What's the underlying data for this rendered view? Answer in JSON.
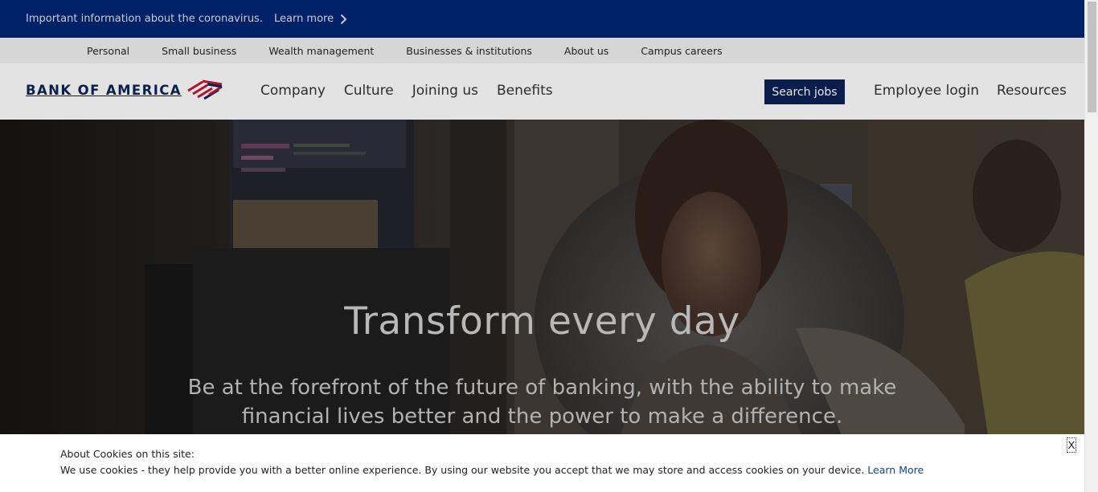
{
  "alert": {
    "text": "Important information about the coronavirus.",
    "link_label": "Learn more"
  },
  "utility_nav": [
    "Personal",
    "Small business",
    "Wealth management",
    "Businesses & institutions",
    "About us",
    "Campus careers"
  ],
  "header": {
    "logo_text": "BANK OF AMERICA",
    "nav": [
      "Company",
      "Culture",
      "Joining us",
      "Benefits"
    ],
    "search_jobs_label": "Search jobs",
    "employee_login_label": "Employee login",
    "resources_label": "Resources"
  },
  "hero": {
    "title": "Transform every day",
    "subtitle": "Be at the forefront of the future of banking, with the ability to make financial lives better and the power to make a difference."
  },
  "cookie": {
    "title": "About Cookies on this site:",
    "text": "We use cookies - they help provide you with a better online experience. By using our website you accept that we may store and access cookies on your device.",
    "link_label": "Learn More",
    "close_label": "X"
  },
  "colors": {
    "alert_bg": "#012169",
    "brand_navy": "#0b1d4d",
    "brand_red": "#b0142c"
  }
}
